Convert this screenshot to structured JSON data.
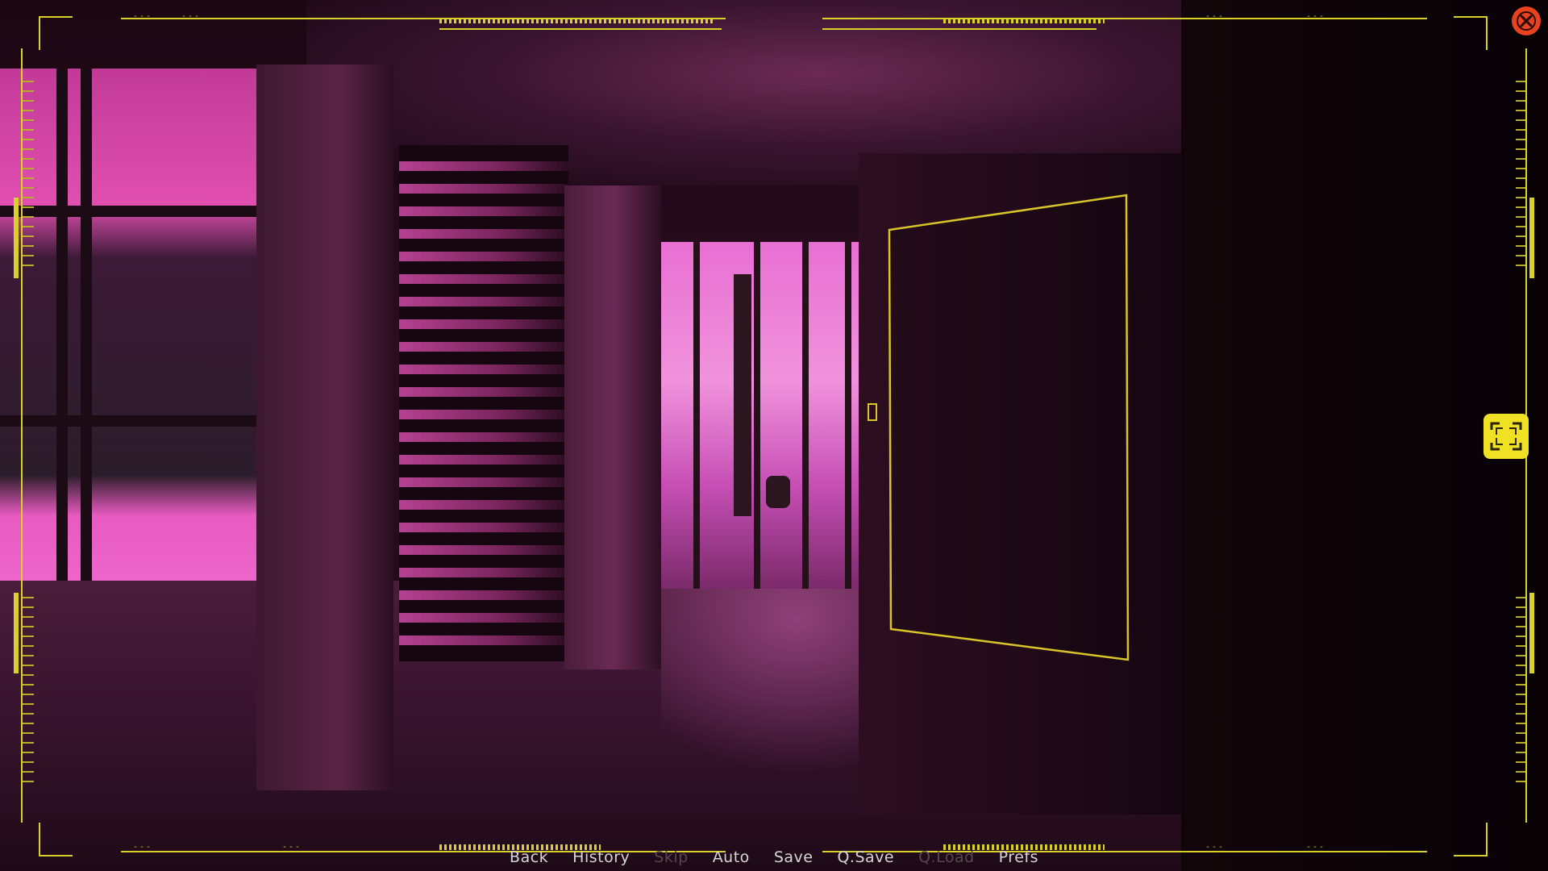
{
  "quick_menu": {
    "items": [
      {
        "label": "Back",
        "enabled": true
      },
      {
        "label": "History",
        "enabled": true
      },
      {
        "label": "Skip",
        "enabled": false
      },
      {
        "label": "Auto",
        "enabled": true
      },
      {
        "label": "Save",
        "enabled": true
      },
      {
        "label": "Q.Save",
        "enabled": true
      },
      {
        "label": "Q.Load",
        "enabled": false
      },
      {
        "label": "Prefs",
        "enabled": true
      }
    ]
  },
  "hud": {
    "accent_color": "#d9d02a",
    "dash_marks": "---"
  },
  "controls": {
    "close_icon": "close-icon",
    "fullscreen_icon": "fullscreen-icon",
    "close_color": "#e8431f",
    "fullscreen_color": "#f0e124"
  },
  "scene": {
    "description_icon": "room-background",
    "neon_color": "#e04fb0",
    "door_highlight_color": "#d9c52a"
  }
}
